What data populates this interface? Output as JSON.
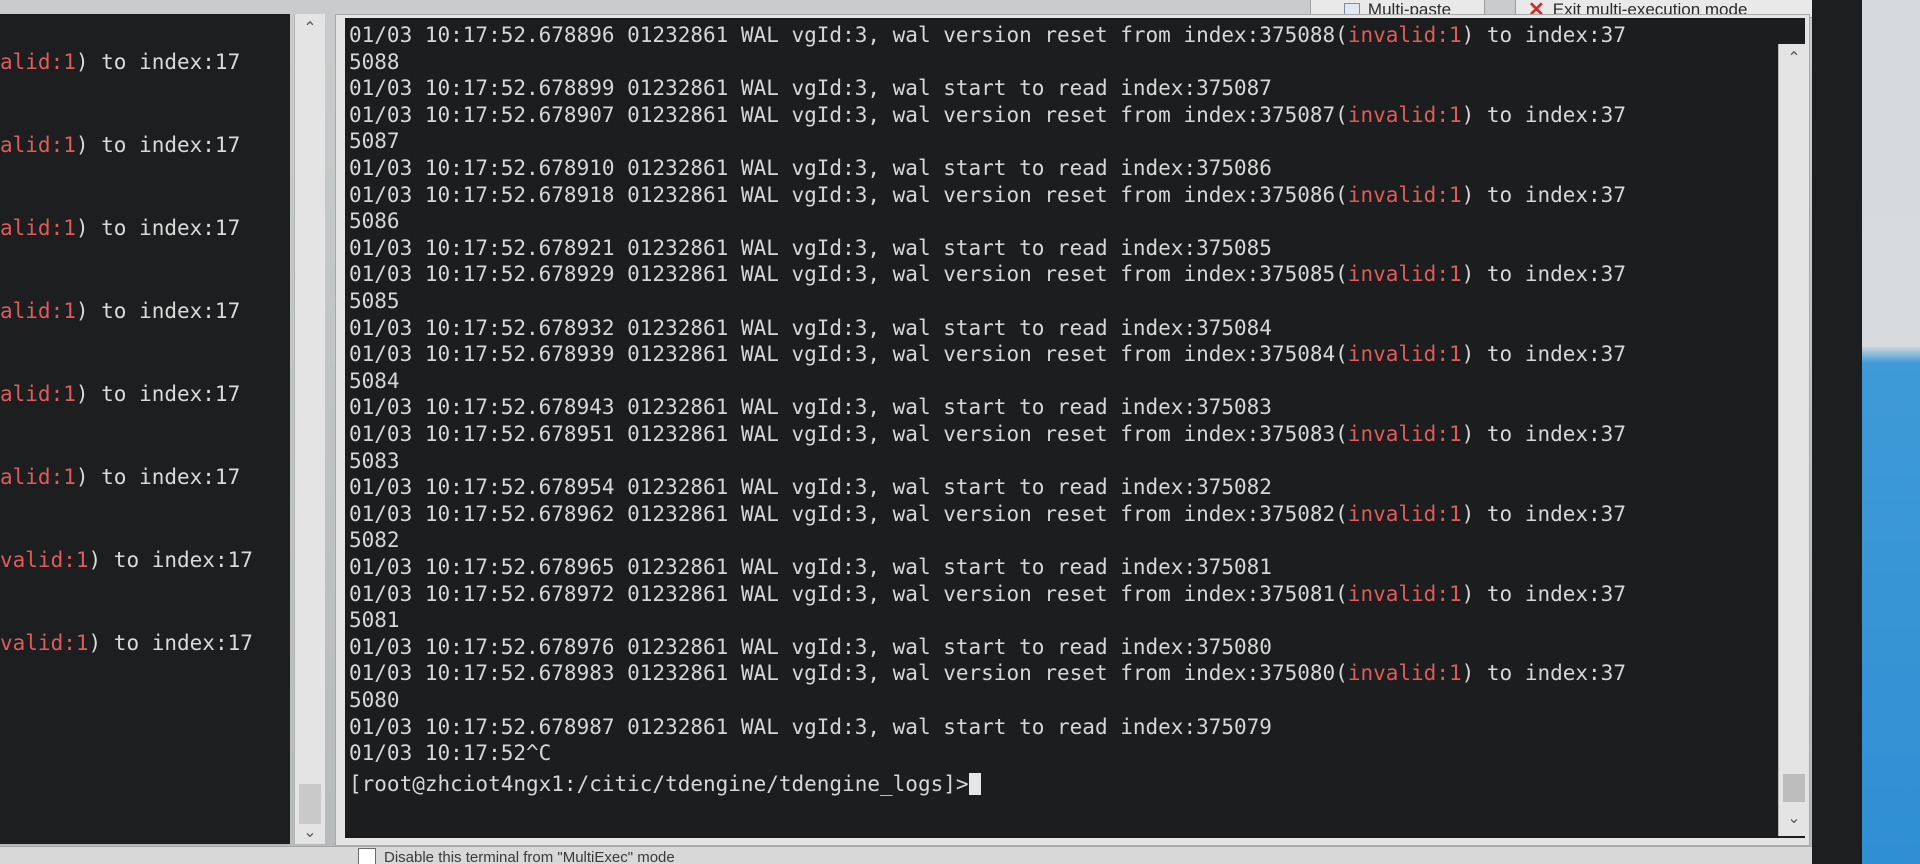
{
  "toolbar": {
    "multi_paste_label": "Multi-paste",
    "exit_multi_label": "Exit multi-execution mode"
  },
  "left_terminal": {
    "lines": [
      {
        "red": "alid:1",
        "rest": ") to index:17"
      },
      {
        "red": "alid:1",
        "rest": ") to index:17"
      },
      {
        "red": "alid:1",
        "rest": ") to index:17"
      },
      {
        "red": "alid:1",
        "rest": ") to index:17"
      },
      {
        "red": "alid:1",
        "rest": ") to index:17"
      },
      {
        "red": "alid:1",
        "rest": ") to index:17"
      },
      {
        "red": "valid:1",
        "rest": ") to index:17"
      },
      {
        "red": "valid:1",
        "rest": ") to index:17"
      }
    ]
  },
  "main_terminal": {
    "lines": [
      {
        "pre": "01/03 10:17:52.678896 01232861 WAL vgId:3, wal version reset from index:375088(",
        "red": "invalid:1",
        "post": ") to index:37"
      },
      {
        "pre": "5088"
      },
      {
        "pre": "01/03 10:17:52.678899 01232861 WAL vgId:3, wal start to read index:375087"
      },
      {
        "pre": "01/03 10:17:52.678907 01232861 WAL vgId:3, wal version reset from index:375087(",
        "red": "invalid:1",
        "post": ") to index:37"
      },
      {
        "pre": "5087"
      },
      {
        "pre": "01/03 10:17:52.678910 01232861 WAL vgId:3, wal start to read index:375086"
      },
      {
        "pre": "01/03 10:17:52.678918 01232861 WAL vgId:3, wal version reset from index:375086(",
        "red": "invalid:1",
        "post": ") to index:37"
      },
      {
        "pre": "5086"
      },
      {
        "pre": "01/03 10:17:52.678921 01232861 WAL vgId:3, wal start to read index:375085"
      },
      {
        "pre": "01/03 10:17:52.678929 01232861 WAL vgId:3, wal version reset from index:375085(",
        "red": "invalid:1",
        "post": ") to index:37"
      },
      {
        "pre": "5085"
      },
      {
        "pre": "01/03 10:17:52.678932 01232861 WAL vgId:3, wal start to read index:375084"
      },
      {
        "pre": "01/03 10:17:52.678939 01232861 WAL vgId:3, wal version reset from index:375084(",
        "red": "invalid:1",
        "post": ") to index:37"
      },
      {
        "pre": "5084"
      },
      {
        "pre": "01/03 10:17:52.678943 01232861 WAL vgId:3, wal start to read index:375083"
      },
      {
        "pre": "01/03 10:17:52.678951 01232861 WAL vgId:3, wal version reset from index:375083(",
        "red": "invalid:1",
        "post": ") to index:37"
      },
      {
        "pre": "5083"
      },
      {
        "pre": "01/03 10:17:52.678954 01232861 WAL vgId:3, wal start to read index:375082"
      },
      {
        "pre": "01/03 10:17:52.678962 01232861 WAL vgId:3, wal version reset from index:375082(",
        "red": "invalid:1",
        "post": ") to index:37"
      },
      {
        "pre": "5082"
      },
      {
        "pre": "01/03 10:17:52.678965 01232861 WAL vgId:3, wal start to read index:375081"
      },
      {
        "pre": "01/03 10:17:52.678972 01232861 WAL vgId:3, wal version reset from index:375081(",
        "red": "invalid:1",
        "post": ") to index:37"
      },
      {
        "pre": "5081"
      },
      {
        "pre": "01/03 10:17:52.678976 01232861 WAL vgId:3, wal start to read index:375080"
      },
      {
        "pre": "01/03 10:17:52.678983 01232861 WAL vgId:3, wal version reset from index:375080(",
        "red": "invalid:1",
        "post": ") to index:37"
      },
      {
        "pre": "5080"
      },
      {
        "pre": "01/03 10:17:52.678987 01232861 WAL vgId:3, wal start to read index:375079"
      },
      {
        "pre": "01/03 10:17:52^C"
      }
    ],
    "prompt": "[root@zhciot4ngx1:/citic/tdengine/tdengine_logs]>"
  },
  "footer": {
    "checkbox_label": "Disable this terminal from \"MultiExec\" mode"
  },
  "icons": {
    "scroll_up": "chevron-up-icon",
    "scroll_down": "chevron-down-icon",
    "exit": "close-icon"
  },
  "colors": {
    "terminal_bg": "#1b1d1e",
    "terminal_text": "#d7d7d7",
    "highlight_red": "#e05b5b"
  }
}
